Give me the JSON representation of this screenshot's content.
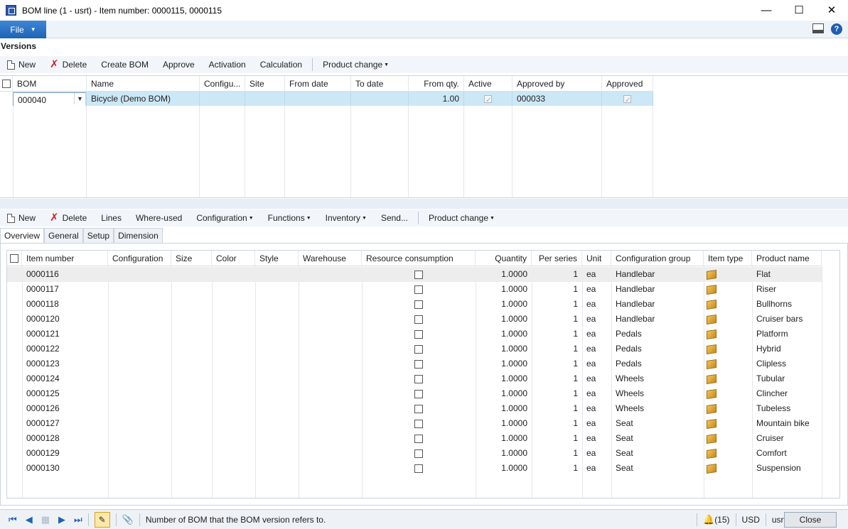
{
  "window": {
    "title": "BOM line (1 - usrt) - Item number: 0000115, 0000115",
    "minimize": "—",
    "maximize": "☐",
    "close": "✕"
  },
  "ribbon": {
    "file_label": "File",
    "file_arrow": "▼",
    "help": "?"
  },
  "versions": {
    "title": "Versions",
    "toolbar": {
      "new": "New",
      "delete": "Delete",
      "create_bom": "Create BOM",
      "approve": "Approve",
      "activation": "Activation",
      "calculation": "Calculation",
      "product_change": "Product change"
    },
    "columns": {
      "bom": "BOM",
      "name": "Name",
      "configuration": "Configu...",
      "site": "Site",
      "from_date": "From date",
      "to_date": "To date",
      "from_qty": "From qty.",
      "active": "Active",
      "approved_by": "Approved by",
      "approved": "Approved"
    },
    "row": {
      "bom": "000040",
      "name": "Bicycle (Demo BOM)",
      "from_qty": "1.00",
      "approved_by": "000033"
    }
  },
  "lines": {
    "toolbar": {
      "new": "New",
      "delete": "Delete",
      "lines": "Lines",
      "where_used": "Where-used",
      "configuration": "Configuration",
      "functions": "Functions",
      "inventory": "Inventory",
      "send": "Send...",
      "product_change": "Product change"
    },
    "tabs": {
      "overview": "Overview",
      "general": "General",
      "setup": "Setup",
      "dimension": "Dimension"
    },
    "columns": {
      "item_number": "Item number",
      "configuration": "Configuration",
      "size": "Size",
      "color": "Color",
      "style": "Style",
      "warehouse": "Warehouse",
      "resource_consumption": "Resource consumption",
      "quantity": "Quantity",
      "per_series": "Per series",
      "unit": "Unit",
      "configuration_group": "Configuration group",
      "item_type": "Item type",
      "product_name": "Product name"
    },
    "rows": [
      {
        "item": "0000116",
        "qty": "1.0000",
        "per": "1",
        "unit": "ea",
        "group": "Handlebar",
        "product": "Flat"
      },
      {
        "item": "0000117",
        "qty": "1.0000",
        "per": "1",
        "unit": "ea",
        "group": "Handlebar",
        "product": "Riser"
      },
      {
        "item": "0000118",
        "qty": "1.0000",
        "per": "1",
        "unit": "ea",
        "group": "Handlebar",
        "product": "Bullhorns"
      },
      {
        "item": "0000120",
        "qty": "1.0000",
        "per": "1",
        "unit": "ea",
        "group": "Handlebar",
        "product": "Cruiser bars"
      },
      {
        "item": "0000121",
        "qty": "1.0000",
        "per": "1",
        "unit": "ea",
        "group": "Pedals",
        "product": "Platform"
      },
      {
        "item": "0000122",
        "qty": "1.0000",
        "per": "1",
        "unit": "ea",
        "group": "Pedals",
        "product": "Hybrid"
      },
      {
        "item": "0000123",
        "qty": "1.0000",
        "per": "1",
        "unit": "ea",
        "group": "Pedals",
        "product": "Clipless"
      },
      {
        "item": "0000124",
        "qty": "1.0000",
        "per": "1",
        "unit": "ea",
        "group": "Wheels",
        "product": "Tubular"
      },
      {
        "item": "0000125",
        "qty": "1.0000",
        "per": "1",
        "unit": "ea",
        "group": "Wheels",
        "product": "Clincher"
      },
      {
        "item": "0000126",
        "qty": "1.0000",
        "per": "1",
        "unit": "ea",
        "group": "Wheels",
        "product": "Tubeless"
      },
      {
        "item": "0000127",
        "qty": "1.0000",
        "per": "1",
        "unit": "ea",
        "group": "Seat",
        "product": "Mountain bike"
      },
      {
        "item": "0000128",
        "qty": "1.0000",
        "per": "1",
        "unit": "ea",
        "group": "Seat",
        "product": "Cruiser"
      },
      {
        "item": "0000129",
        "qty": "1.0000",
        "per": "1",
        "unit": "ea",
        "group": "Seat",
        "product": "Comfort"
      },
      {
        "item": "0000130",
        "qty": "1.0000",
        "per": "1",
        "unit": "ea",
        "group": "Seat",
        "product": "Suspension"
      }
    ]
  },
  "statusbar": {
    "help_text": "Number of BOM that the BOM version refers to.",
    "notifications": "(15)",
    "currency": "USD",
    "company": "usrt",
    "close_label": "Close"
  },
  "colors": {
    "accent": "#1f63b4",
    "selected_row": "#cce8f6"
  }
}
